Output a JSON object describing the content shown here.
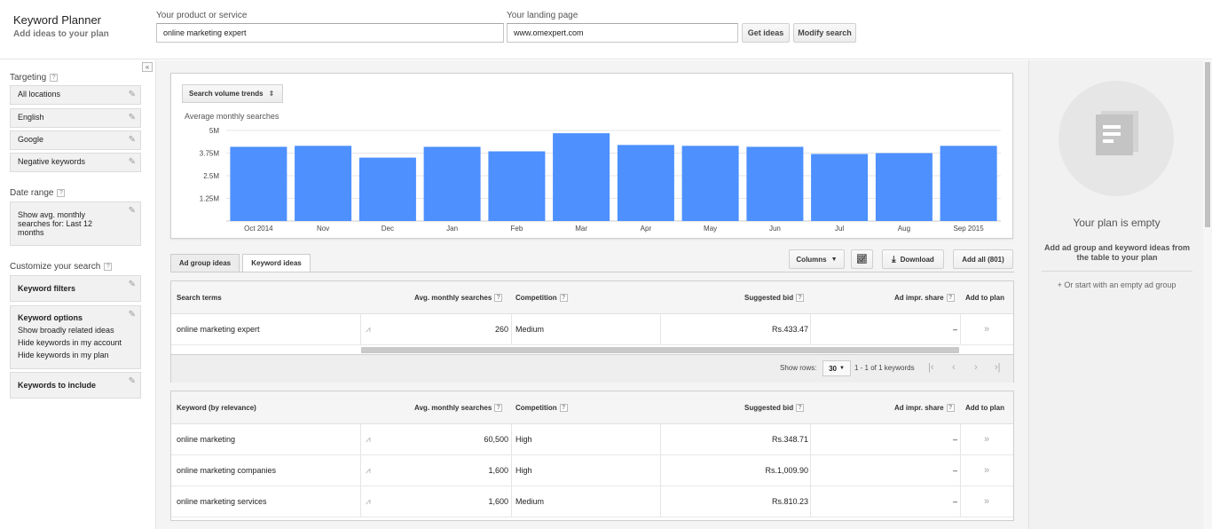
{
  "header": {
    "title": "Keyword Planner",
    "subtitle": "Add ideas to your plan",
    "product_label": "Your product or service",
    "product_value": "online marketing expert",
    "landing_label": "Your landing page",
    "landing_value": "www.omexpert.com",
    "get_ideas": "Get ideas",
    "modify_search": "Modify search"
  },
  "sidebar": {
    "collapse_glyph": "«",
    "targeting_label": "Targeting",
    "targeting_items": [
      "All locations",
      "English",
      "Google",
      "Negative keywords"
    ],
    "date_range_label": "Date range",
    "date_range_text": [
      "Show avg. monthly",
      "searches for: Last 12",
      "months"
    ],
    "customize_label": "Customize your search",
    "keyword_filters": "Keyword filters",
    "keyword_options_title": "Keyword options",
    "keyword_options": [
      "Show broadly related ideas",
      "Hide keywords in my account",
      "Hide keywords in my plan"
    ],
    "keywords_to_include": "Keywords to include"
  },
  "chart_panel": {
    "selector": "Search volume trends",
    "y_title": "Average monthly searches"
  },
  "chart_data": {
    "type": "bar",
    "title": "",
    "ylabel": "Average monthly searches",
    "categories": [
      "Oct 2014",
      "Nov",
      "Dec",
      "Jan",
      "Feb",
      "Mar",
      "Apr",
      "May",
      "Jun",
      "Jul",
      "Aug",
      "Sep 2015"
    ],
    "values": [
      4100000,
      4150000,
      3500000,
      4100000,
      3850000,
      4850000,
      4200000,
      4150000,
      4100000,
      3700000,
      3750000,
      4150000
    ],
    "yticks": [
      "5M",
      "3.75M",
      "2.5M",
      "1.25M"
    ],
    "ytick_values": [
      5000000,
      3750000,
      2500000,
      1250000
    ],
    "ylim": [
      0,
      5000000
    ],
    "color": "#4d90fe",
    "grid": true
  },
  "tabs": {
    "ad_group": "Ad group ideas",
    "keyword": "Keyword ideas"
  },
  "toolbar": {
    "columns": "Columns",
    "download": "Download",
    "add_all": "Add all (801)"
  },
  "search_table": {
    "headers": {
      "term": "Search terms",
      "avg": "Avg. monthly searches",
      "competition": "Competition",
      "bid": "Suggested bid",
      "impr": "Ad impr. share",
      "add": "Add to plan"
    },
    "rows": [
      {
        "keyword": "online marketing expert",
        "avg": "260",
        "competition": "Medium",
        "bid": "Rs.433.47",
        "impr": "–",
        "add": "»"
      }
    ]
  },
  "pager": {
    "show_rows": "Show rows:",
    "rows_value": "30",
    "range": "1 - 1 of 1 keywords"
  },
  "ideas_table": {
    "headers": {
      "term": "Keyword (by relevance)",
      "avg": "Avg. monthly searches",
      "competition": "Competition",
      "bid": "Suggested bid",
      "impr": "Ad impr. share",
      "add": "Add to plan"
    },
    "rows": [
      {
        "keyword": "online marketing",
        "avg": "60,500",
        "competition": "High",
        "bid": "Rs.348.71",
        "impr": "–",
        "add": "»"
      },
      {
        "keyword": "online marketing companies",
        "avg": "1,600",
        "competition": "High",
        "bid": "Rs.1,009.90",
        "impr": "–",
        "add": "»"
      },
      {
        "keyword": "online marketing services",
        "avg": "1,600",
        "competition": "Medium",
        "bid": "Rs.810.23",
        "impr": "–",
        "add": "»"
      }
    ]
  },
  "plan": {
    "title": "Your plan is empty",
    "desc": "Add ad group and keyword ideas from the table to your plan",
    "link": "+ Or start with an empty ad group"
  }
}
